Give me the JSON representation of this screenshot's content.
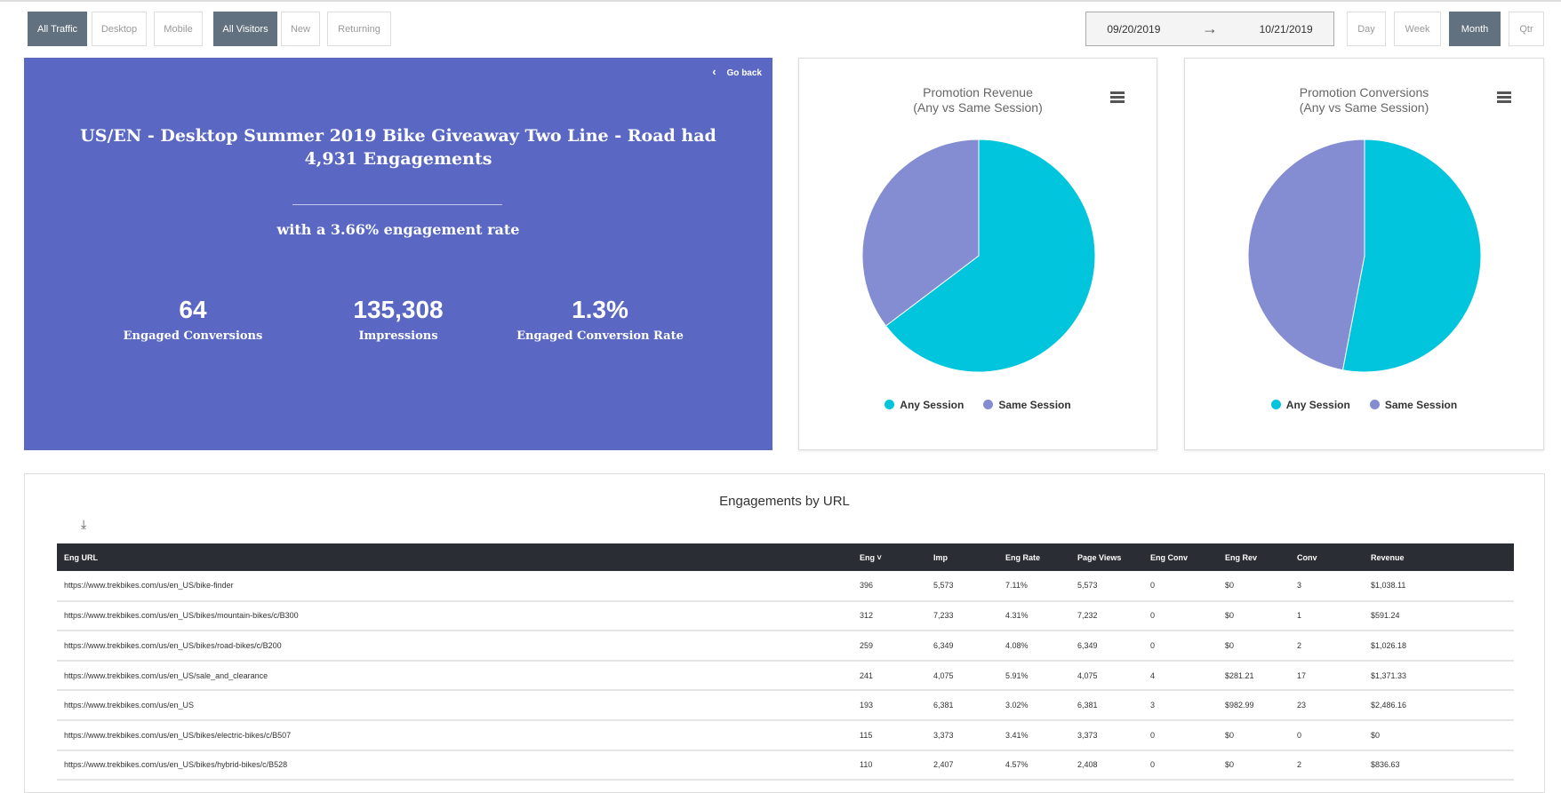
{
  "filters": {
    "traffic": [
      "All Traffic",
      "Desktop",
      "Mobile"
    ],
    "visitors": [
      "All Visitors",
      "New",
      "Returning"
    ],
    "active_traffic": "All Traffic",
    "active_visitors": "All Visitors"
  },
  "date_range": {
    "start": "09/20/2019",
    "arrow": "→",
    "end": "10/21/2019"
  },
  "periods": [
    "Day",
    "Week",
    "Month",
    "Qtr"
  ],
  "active_period": "Month",
  "hero": {
    "go_back": "Go back",
    "headline": "US/EN - Desktop Summer 2019 Bike Giveaway Two Line - Road had 4,931 Engagements",
    "rate": "with a 3.66% engagement rate",
    "stats": [
      {
        "value": "64",
        "label": "Engaged Conversions"
      },
      {
        "value": "135,308",
        "label": "Impressions"
      },
      {
        "value": "1.3%",
        "label": "Engaged Conversion Rate"
      }
    ]
  },
  "chart_data": [
    {
      "type": "pie",
      "title": "Promotion Revenue",
      "subtitle": "(Any vs Same Session)",
      "categories": [
        "Any Session",
        "Same Session"
      ],
      "values": [
        64.7,
        35.3
      ],
      "colors": [
        "#00c5dc",
        "#848dd2"
      ],
      "legend": "bottom"
    },
    {
      "type": "pie",
      "title": "Promotion Conversions",
      "subtitle": "(Any vs Same Session)",
      "categories": [
        "Any Session",
        "Same Session"
      ],
      "values": [
        53,
        47
      ],
      "colors": [
        "#00c5dc",
        "#848dd2"
      ],
      "legend": "bottom"
    }
  ],
  "table": {
    "title": "Engagements by URL",
    "columns": [
      "Eng URL",
      "Eng ˅",
      "Imp",
      "Eng Rate",
      "Page Views",
      "Eng Conv",
      "Eng Rev",
      "Conv",
      "Revenue"
    ],
    "rows": [
      [
        "https://www.trekbikes.com/us/en_US/bike-finder",
        "396",
        "5,573",
        "7.11%",
        "5,573",
        "0",
        "$0",
        "3",
        "$1,038.11"
      ],
      [
        "https://www.trekbikes.com/us/en_US/bikes/mountain-bikes/c/B300",
        "312",
        "7,233",
        "4.31%",
        "7,232",
        "0",
        "$0",
        "1",
        "$591.24"
      ],
      [
        "https://www.trekbikes.com/us/en_US/bikes/road-bikes/c/B200",
        "259",
        "6,349",
        "4.08%",
        "6,349",
        "0",
        "$0",
        "2",
        "$1,026.18"
      ],
      [
        "https://www.trekbikes.com/us/en_US/sale_and_clearance",
        "241",
        "4,075",
        "5.91%",
        "4,075",
        "4",
        "$281.21",
        "17",
        "$1,371.33"
      ],
      [
        "https://www.trekbikes.com/us/en_US",
        "193",
        "6,381",
        "3.02%",
        "6,381",
        "3",
        "$982.99",
        "23",
        "$2,486.16"
      ],
      [
        "https://www.trekbikes.com/us/en_US/bikes/electric-bikes/c/B507",
        "115",
        "3,373",
        "3.41%",
        "3,373",
        "0",
        "$0",
        "0",
        "$0"
      ],
      [
        "https://www.trekbikes.com/us/en_US/bikes/hybrid-bikes/c/B528",
        "110",
        "2,407",
        "4.57%",
        "2,408",
        "0",
        "$0",
        "2",
        "$836.63"
      ]
    ]
  }
}
